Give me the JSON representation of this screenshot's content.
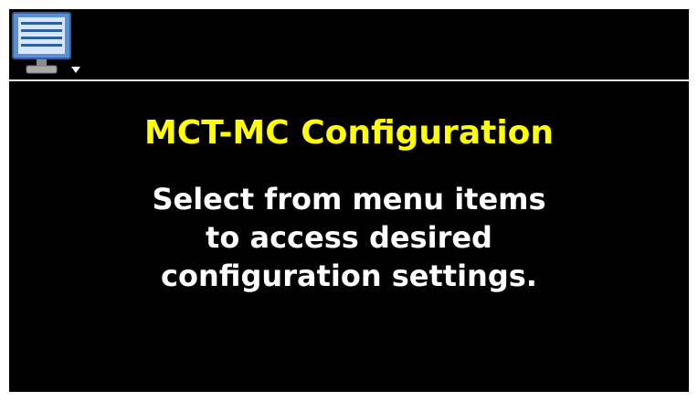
{
  "header": {
    "menu_icon": "monitor-list-menu-icon"
  },
  "main": {
    "title": "MCT-MC Configuration",
    "message_lines": [
      "Select from menu items",
      "to access desired",
      "configuration settings."
    ]
  },
  "colors": {
    "background": "#000000",
    "title": "#ffff00",
    "message": "#ffffff",
    "divider": "#e6e6e6",
    "icon_frame": "#5b8fd4",
    "icon_screen": "#d6e6fb",
    "icon_stand": "#a9a9a9"
  }
}
